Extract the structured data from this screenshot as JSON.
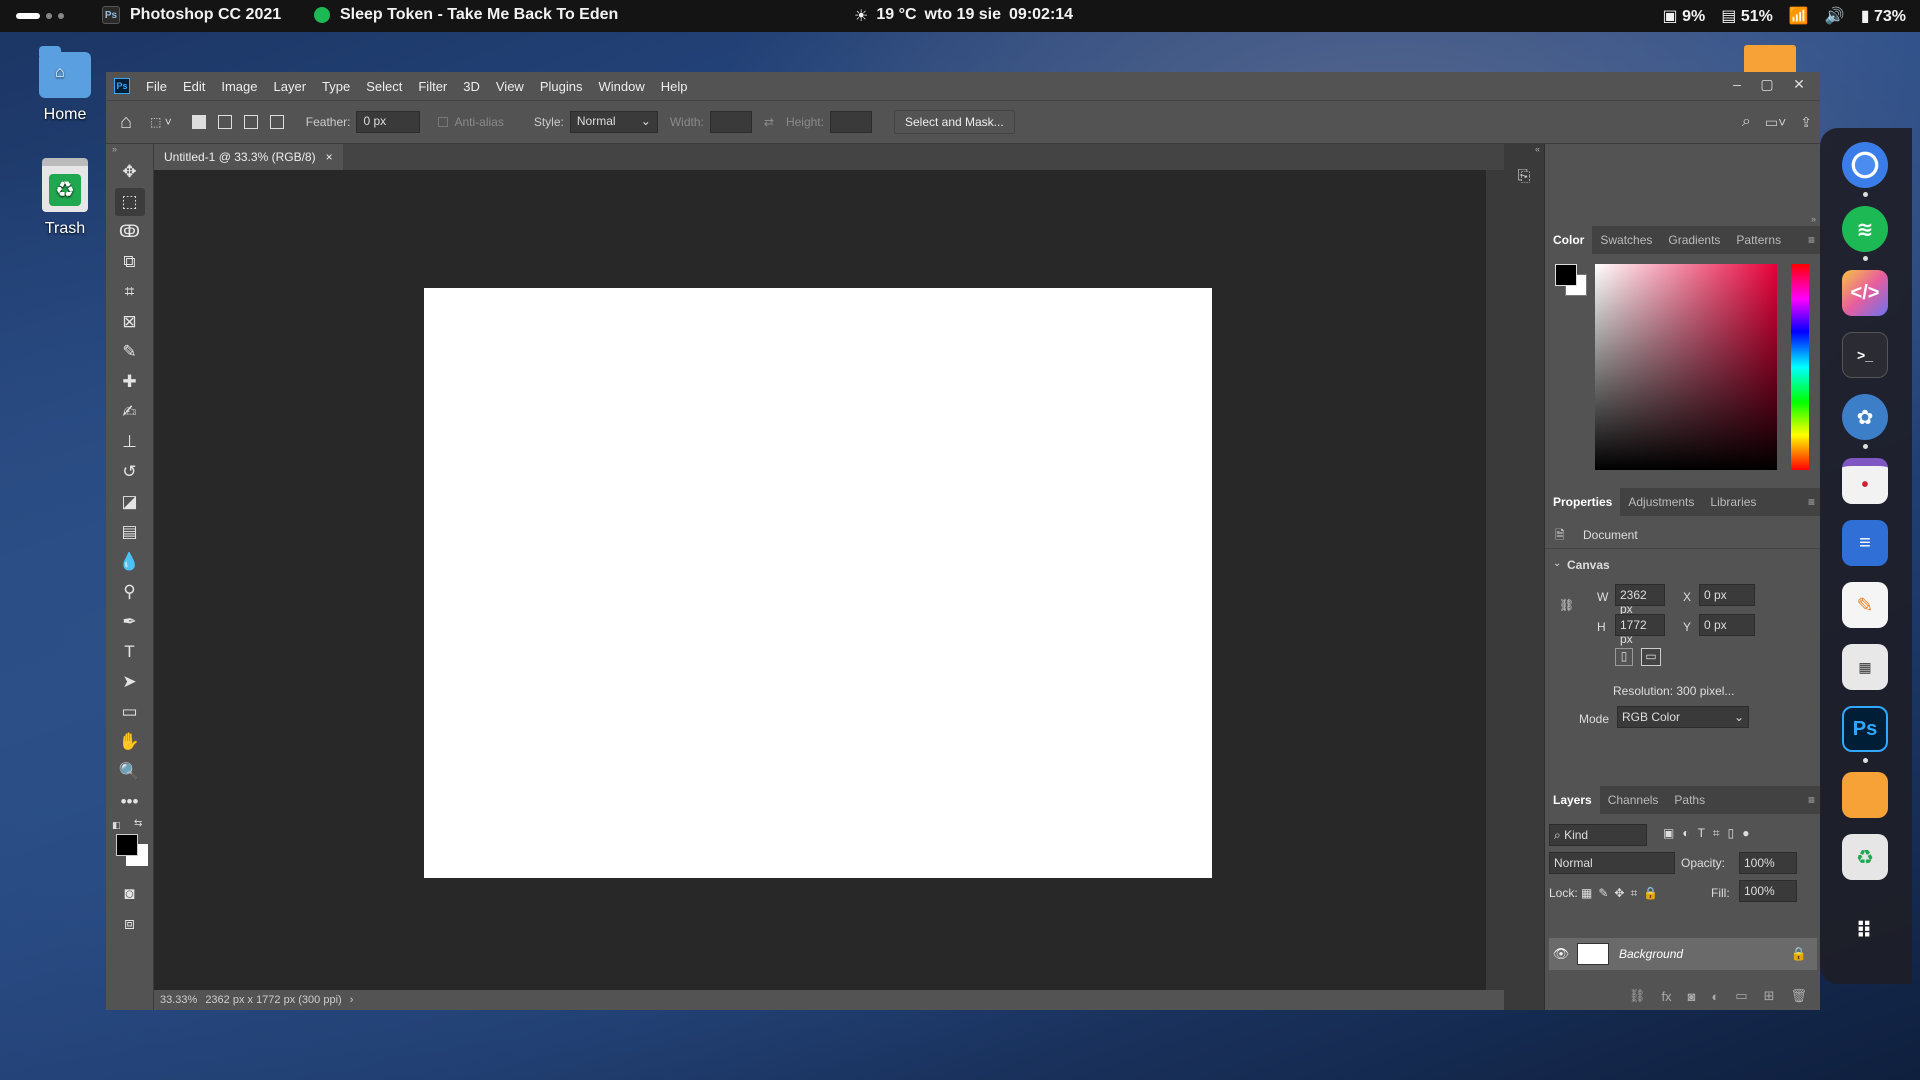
{
  "topbar": {
    "app_name": "Photoshop CC 2021",
    "media_title": "Sleep Token - Take Me Back To Eden",
    "weather": "19 °C",
    "date": "wto 19 sie",
    "time": "09:02:14",
    "cpu": "9%",
    "memory": "51%",
    "battery": "73%"
  },
  "desktop": {
    "home_label": "Home",
    "trash_label": "Trash"
  },
  "menubar": {
    "items": [
      "File",
      "Edit",
      "Image",
      "Layer",
      "Type",
      "Select",
      "Filter",
      "3D",
      "View",
      "Plugins",
      "Window",
      "Help"
    ]
  },
  "options": {
    "feather_label": "Feather:",
    "feather_value": "0 px",
    "antialias_label": "Anti-alias",
    "style_label": "Style:",
    "style_value": "Normal",
    "width_label": "Width:",
    "height_label": "Height:",
    "select_mask_label": "Select and Mask..."
  },
  "document": {
    "tab_title": "Untitled-1 @ 33.3% (RGB/8)",
    "zoom": "33.33%",
    "status": "2362 px x 1772 px (300 ppi)"
  },
  "color_panel": {
    "tabs": [
      "Color",
      "Swatches",
      "Gradients",
      "Patterns"
    ],
    "foreground": "#000000",
    "background": "#ffffff"
  },
  "properties_panel": {
    "tabs": [
      "Properties",
      "Adjustments",
      "Libraries"
    ],
    "doc_label": "Document",
    "canvas_label": "Canvas",
    "w_label": "W",
    "w_value": "2362 px",
    "h_label": "H",
    "h_value": "1772 px",
    "x_label": "X",
    "x_value": "0 px",
    "y_label": "Y",
    "y_value": "0 px",
    "resolution": "Resolution: 300 pixel...",
    "mode_label": "Mode",
    "mode_value": "RGB Color"
  },
  "layers_panel": {
    "tabs": [
      "Layers",
      "Channels",
      "Paths"
    ],
    "kind_placeholder": "Kind",
    "blend_mode": "Normal",
    "opacity_label": "Opacity:",
    "opacity_value": "100%",
    "lock_label": "Lock:",
    "fill_label": "Fill:",
    "fill_value": "100%",
    "layer_name": "Background"
  },
  "dock": {
    "apps": [
      "chrome-icon",
      "spotify-icon",
      "vscode-icon",
      "terminal-icon",
      "krita-icon",
      "calendar-icon",
      "archive-icon",
      "text-editor-icon",
      "calculator-icon",
      "photoshop-icon",
      "files-icon",
      "trash-icon",
      "app-grid-icon"
    ],
    "ps_label": "Ps"
  }
}
